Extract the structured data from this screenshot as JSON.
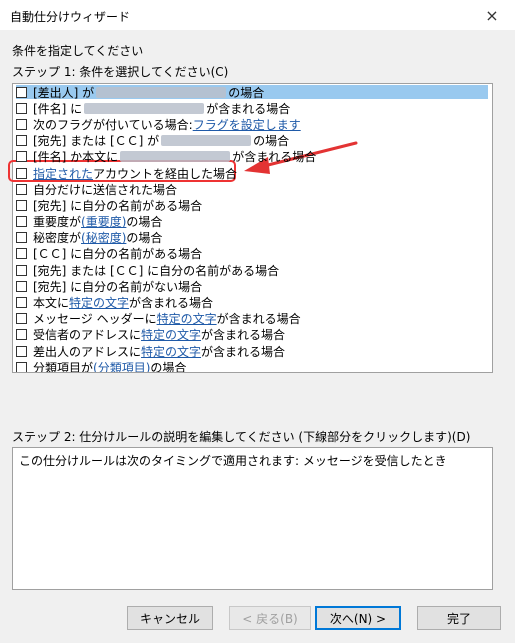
{
  "window": {
    "title": "自動仕分けウィザード",
    "close_icon": "×"
  },
  "step_intro": "条件を指定してください",
  "step1_label": "ステップ 1: 条件を選択してください(C)",
  "conditions": [
    {
      "parts": [
        {
          "t": "[差出人] が "
        },
        {
          "blur": 130
        },
        {
          "t": " の場合"
        }
      ],
      "selected": true
    },
    {
      "parts": [
        {
          "t": "[件名] に "
        },
        {
          "blur": 120
        },
        {
          "t": " が含まれる場合"
        }
      ]
    },
    {
      "parts": [
        {
          "t": "次のフラグが付いている場合: "
        },
        {
          "link": "フラグを設定します"
        }
      ]
    },
    {
      "parts": [
        {
          "t": "[宛先] または [ＣＣ] が "
        },
        {
          "blur": 90
        },
        {
          "t": " の場合"
        }
      ]
    },
    {
      "parts": [
        {
          "t": "[件名] か本文に "
        },
        {
          "blur": 110
        },
        {
          "t": " が含まれる場合"
        }
      ]
    },
    {
      "parts": [
        {
          "link": "指定された"
        },
        {
          "t": " アカウントを経由した場合"
        }
      ]
    },
    {
      "parts": [
        {
          "t": "自分だけに送信された場合"
        }
      ]
    },
    {
      "parts": [
        {
          "t": "[宛先] に自分の名前がある場合"
        }
      ]
    },
    {
      "parts": [
        {
          "t": "重要度が "
        },
        {
          "link": "(重要度)"
        },
        {
          "t": " の場合"
        }
      ]
    },
    {
      "parts": [
        {
          "t": "秘密度が "
        },
        {
          "link": "(秘密度)"
        },
        {
          "t": " の場合"
        }
      ]
    },
    {
      "parts": [
        {
          "t": "[ＣＣ] に自分の名前がある場合"
        }
      ]
    },
    {
      "parts": [
        {
          "t": "[宛先] または [ＣＣ] に自分の名前がある場合"
        }
      ]
    },
    {
      "parts": [
        {
          "t": "[宛先] に自分の名前がない場合"
        }
      ]
    },
    {
      "parts": [
        {
          "t": "本文に "
        },
        {
          "link": "特定の文字"
        },
        {
          "t": " が含まれる場合"
        }
      ]
    },
    {
      "parts": [
        {
          "t": "メッセージ ヘッダーに "
        },
        {
          "link": "特定の文字"
        },
        {
          "t": " が含まれる場合"
        }
      ]
    },
    {
      "parts": [
        {
          "t": "受信者のアドレスに "
        },
        {
          "link": "特定の文字"
        },
        {
          "t": " が含まれる場合"
        }
      ]
    },
    {
      "parts": [
        {
          "t": "差出人のアドレスに "
        },
        {
          "link": "特定の文字"
        },
        {
          "t": " が含まれる場合"
        }
      ]
    },
    {
      "parts": [
        {
          "t": "分類項目が "
        },
        {
          "link": "(分類項目)"
        },
        {
          "t": " の場合"
        }
      ]
    }
  ],
  "step2_label": "ステップ 2: 仕分けルールの説明を編集してください (下線部分をクリックします)(D)",
  "description": "この仕分けルールは次のタイミングで適用されます: メッセージを受信したとき",
  "buttons": {
    "cancel": "キャンセル",
    "back": "< 戻る(B)",
    "next": "次へ(N) >",
    "finish": "完了"
  },
  "colors": {
    "annotation": "#e33333",
    "link": "#1f5aa8",
    "selection": "#99c9ef"
  }
}
